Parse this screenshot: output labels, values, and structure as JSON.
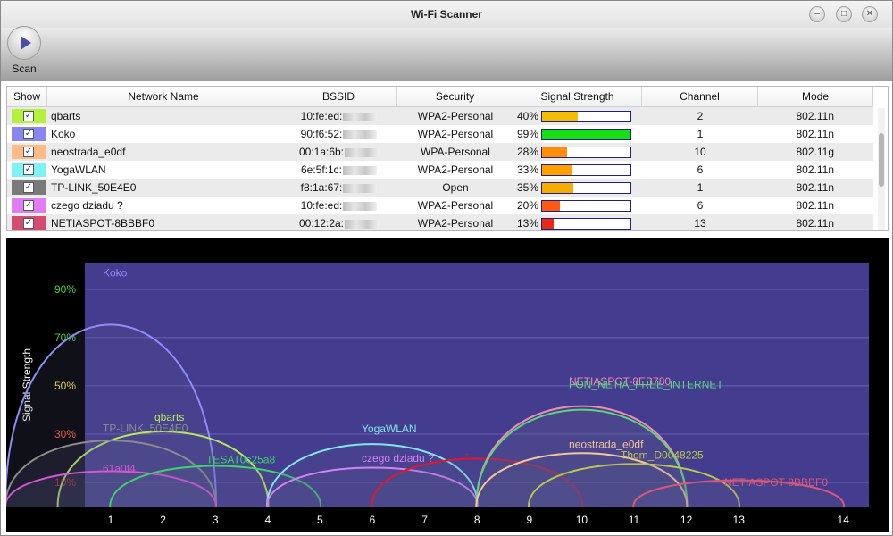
{
  "window": {
    "title": "Wi-Fi Scanner"
  },
  "window_controls": {
    "minimize": "–",
    "maximize": "□",
    "close": "✕"
  },
  "toolbar": {
    "scan_label": "Scan"
  },
  "table": {
    "headers": [
      "Show",
      "Network Name",
      "BSSID",
      "Security",
      "Signal Strength",
      "Channel",
      "Mode"
    ],
    "rows": [
      {
        "color": "#b5f03a",
        "checked": "✓",
        "name": "qbarts",
        "bssid": "10:fe:ed:",
        "security": "WPA2-Personal",
        "signal": "40%",
        "signal_value": 40,
        "bar_color": "#f4bd00",
        "channel": "2",
        "mode": "802.11n"
      },
      {
        "color": "#8a86f0",
        "checked": "✓",
        "name": "Koko",
        "bssid": "90:f6:52:",
        "security": "WPA2-Personal",
        "signal": "99%",
        "signal_value": 99,
        "bar_color": "#16e013",
        "channel": "1",
        "mode": "802.11n"
      },
      {
        "color": "#fdbb86",
        "checked": "✓",
        "name": "neostrada_e0df",
        "bssid": "00:1a:6b:",
        "security": "WPA-Personal",
        "signal": "28%",
        "signal_value": 28,
        "bar_color": "#ff8c0a",
        "channel": "10",
        "mode": "802.11g"
      },
      {
        "color": "#7ff3f3",
        "checked": "✓",
        "name": "YogaWLAN",
        "bssid": "6e:5f:1c:",
        "security": "WPA2-Personal",
        "signal": "33%",
        "signal_value": 33,
        "bar_color": "#ffa000",
        "channel": "6",
        "mode": "802.11n"
      },
      {
        "color": "#7a7a7a",
        "checked": "✓",
        "name": "TP-LINK_50E4E0",
        "bssid": "f8:1a:67:",
        "security": "Open",
        "signal": "35%",
        "signal_value": 35,
        "bar_color": "#f6ac00",
        "channel": "1",
        "mode": "802.11n"
      },
      {
        "color": "#e17cf2",
        "checked": "✓",
        "name": "czego dziadu ?",
        "bssid": "10:fe:ed:",
        "security": "WPA2-Personal",
        "signal": "20%",
        "signal_value": 20,
        "bar_color": "#ff5a10",
        "channel": "6",
        "mode": "802.11n"
      },
      {
        "color": "#d44d71",
        "checked": "✓",
        "name": "NETIASPOT-8BBBF0",
        "bssid": "00:12:2a:",
        "security": "WPA2-Personal",
        "signal": "13%",
        "signal_value": 13,
        "bar_color": "#e82a10",
        "channel": "13",
        "mode": "802.11n"
      }
    ]
  },
  "graph": {
    "y_axis_title": "Signal Strength",
    "y_ticks": [
      {
        "label": "90%",
        "value": 90,
        "color": "#48d848"
      },
      {
        "label": "70%",
        "value": 70,
        "color": "#48d848"
      },
      {
        "label": "50%",
        "value": 50,
        "color": "#f0e04a"
      },
      {
        "label": "30%",
        "value": 30,
        "color": "#ff5a3a"
      },
      {
        "label": "10%",
        "value": 10,
        "color": "#e01616"
      }
    ],
    "x_ticks": [
      "1",
      "2",
      "3",
      "4",
      "5",
      "6",
      "7",
      "8",
      "9",
      "10",
      "11",
      "12",
      "13",
      "14"
    ],
    "networks": [
      {
        "name": "Koko",
        "channel": 1,
        "strength": 99,
        "color": "#8f8df5"
      },
      {
        "name": "qbarts",
        "channel": 2,
        "strength": 40,
        "color": "#b9e85a"
      },
      {
        "name": "TP-LINK_50E4E0",
        "channel": 1,
        "strength": 35,
        "color": "#8c8c8c"
      },
      {
        "name": "61a0f4",
        "channel": 1,
        "strength": 18,
        "color": "#d458d4"
      },
      {
        "name": "TESAT0c25a8",
        "channel": 3,
        "strength": 21,
        "color": "#3ed26e"
      },
      {
        "name": "YogaWLAN",
        "channel": 6,
        "strength": 33,
        "color": "#82e6ee"
      },
      {
        "name": "czego dziadu ?",
        "channel": 6,
        "strength": 20,
        "color": "#d283f2"
      },
      {
        "name": "-",
        "channel": 8,
        "strength": 25,
        "color": "#e0182f"
      },
      {
        "name": "NETIASPOT-8EB780",
        "channel": 10,
        "strength": 54,
        "color": "#f08ab5"
      },
      {
        "name": "FON_NETIA_FREE_INTERNET",
        "channel": 10,
        "strength": 52,
        "color": "#58d878"
      },
      {
        "name": "neostrada_e0df",
        "channel": 10,
        "strength": 28,
        "color": "#f3c79b"
      },
      {
        "name": "Thom_D0048225",
        "channel": 11,
        "strength": 22,
        "color": "#b8c74e"
      },
      {
        "name": "NETIASPOT-8BBBF0",
        "channel": 13,
        "strength": 13,
        "color": "#d9577a"
      }
    ]
  }
}
